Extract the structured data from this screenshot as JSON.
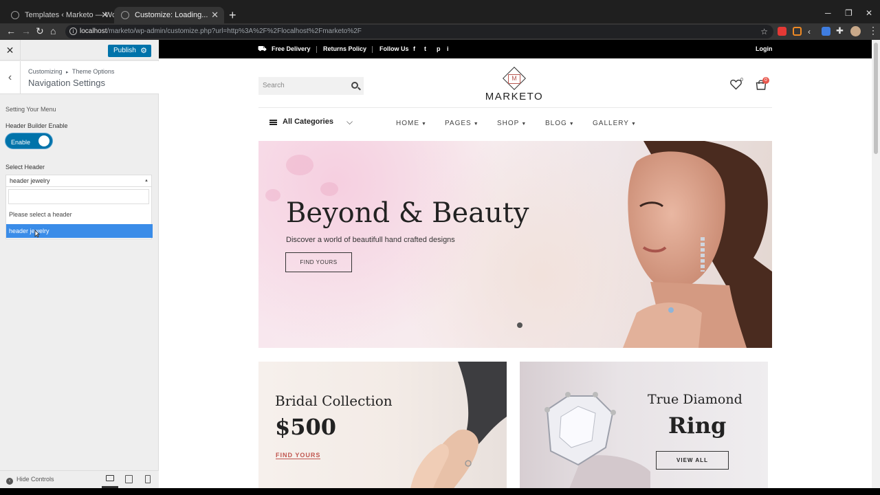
{
  "browser": {
    "tabs": [
      {
        "title": "Templates ‹ Marketo — WordPress",
        "active": false
      },
      {
        "title": "Customize: Loading...",
        "active": true
      }
    ],
    "new_tab": "+",
    "url_host": "localhost",
    "url_path": "/marketo/wp-admin/customize.php?url=http%3A%2F%2Flocalhost%2Fmarketo%2F",
    "icons": [
      "back-icon",
      "forward-icon",
      "reload-icon",
      "home-icon",
      "star-icon",
      "extensions-icon",
      "profile-avatar",
      "kebab-menu-icon"
    ]
  },
  "customizer": {
    "close": "✕",
    "publish_label": "Publish",
    "breadcrumb_root": "Customizing",
    "breadcrumb_sep": "▸",
    "breadcrumb_section": "Theme Options",
    "section_title": "Navigation Settings",
    "group_label": "Setting Your Menu",
    "header_builder_label": "Header Builder Enable",
    "toggle_label": "Enable",
    "select_header_label": "Select Header",
    "select_value": "header jewelry",
    "options": [
      "Please select a header",
      "header jewelry"
    ],
    "highlighted_option": "header jewelry",
    "hide_controls": "Hide Controls"
  },
  "site": {
    "topbar": {
      "free_delivery": "Free Delivery",
      "returns_policy": "Returns Policy",
      "follow_us": "Follow Us",
      "social": [
        "f",
        "t",
        "p",
        "i"
      ],
      "login": "Login"
    },
    "search_placeholder": "Search",
    "logo_mark": "M",
    "logo_text": "MARKETO",
    "wishlist_count": "0",
    "cart_count": "0",
    "all_categories": "All Categories",
    "nav": [
      "HOME",
      "PAGES",
      "SHOP",
      "BLOG",
      "GALLERY"
    ],
    "hero": {
      "title": "Beyond & Beauty",
      "subtitle": "Discover a world of beautifull hand crafted designs",
      "button": "FIND YOURS"
    },
    "banner1": {
      "title": "Bridal Collection",
      "price": "$500",
      "link": "FIND YOURS"
    },
    "banner2": {
      "title_line1": "True Diamond",
      "title_line2": "Ring",
      "button": "VIEW ALL"
    }
  },
  "colors": {
    "accent_blue": "#0073aa",
    "option_highlight": "#3a8ce8",
    "brand_red": "#c0554e"
  }
}
